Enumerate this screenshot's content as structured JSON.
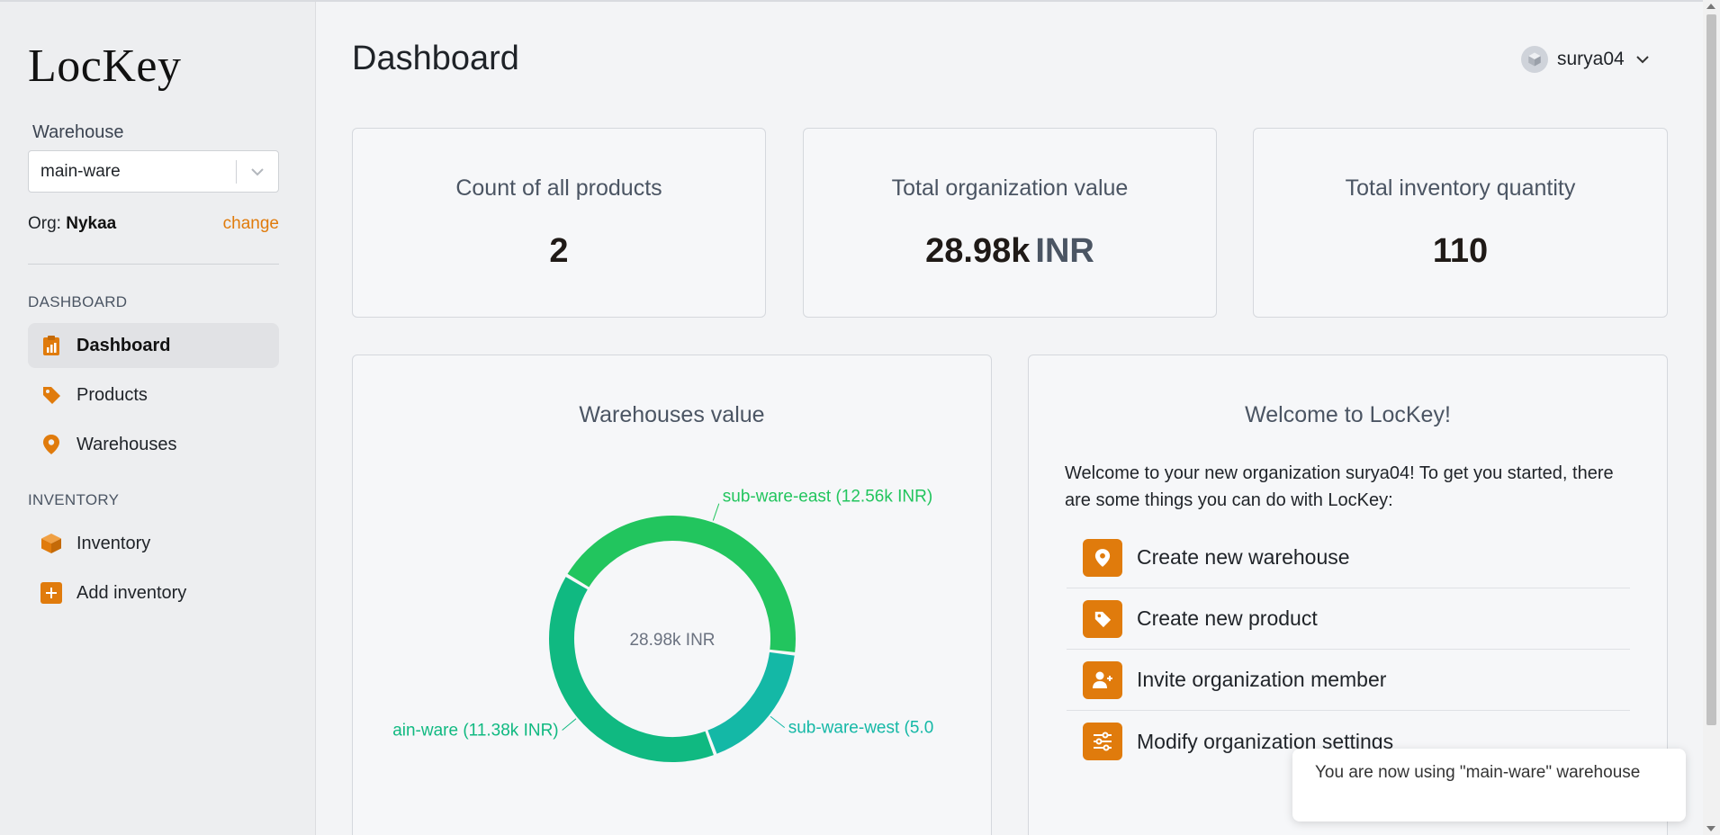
{
  "app": {
    "logo": "LocKey"
  },
  "sidebar": {
    "warehouse_label": "Warehouse",
    "warehouse_value": "main-ware",
    "org_label": "Org:",
    "org_name": "Nykaa",
    "change_label": "change",
    "sections": {
      "dashboard": "DASHBOARD",
      "inventory": "INVENTORY"
    },
    "items": [
      {
        "label": "Dashboard",
        "icon": "clipboard-chart-icon",
        "active": true
      },
      {
        "label": "Products",
        "icon": "tag-icon"
      },
      {
        "label": "Warehouses",
        "icon": "map-pin-icon"
      },
      {
        "label": "Inventory",
        "icon": "cube-icon"
      },
      {
        "label": "Add inventory",
        "icon": "plus-square-icon"
      }
    ]
  },
  "header": {
    "title": "Dashboard",
    "username": "surya04"
  },
  "stats": [
    {
      "label": "Count of all products",
      "value": "2",
      "unit": ""
    },
    {
      "label": "Total organization value",
      "value": "28.98k",
      "unit": "INR"
    },
    {
      "label": "Total inventory quantity",
      "value": "110",
      "unit": ""
    }
  ],
  "warehouses_panel": {
    "title": "Warehouses value"
  },
  "chart_data": {
    "type": "pie",
    "donut": true,
    "title": "Warehouses value",
    "center_label": "28.98k INR",
    "labels": [
      "sub-ware-east (12.56k INR)",
      "sub-ware-west (5.0",
      "ain-ware (11.38k INR)"
    ],
    "series": [
      {
        "name": "sub-ware-east",
        "value": 12.56,
        "color": "#22c55e"
      },
      {
        "name": "sub-ware-west",
        "value": 5.04,
        "color": "#14b8a6"
      },
      {
        "name": "main-ware",
        "value": 11.38,
        "color": "#10b981"
      }
    ],
    "unit": "k INR"
  },
  "welcome": {
    "title": "Welcome to LocKey!",
    "text": "Welcome to your new organization surya04! To get you started, there are some things you can do with LocKey:",
    "actions": [
      {
        "label": "Create new warehouse",
        "icon": "map-pin-icon"
      },
      {
        "label": "Create new product",
        "icon": "tag-icon"
      },
      {
        "label": "Invite organization member",
        "icon": "user-plus-icon"
      },
      {
        "label": "Modify organization settings",
        "icon": "sliders-icon"
      }
    ]
  },
  "toast": {
    "message": "You are now using \"main-ware\" warehouse"
  },
  "colors": {
    "accent": "#e07b0c",
    "chart_green": "#22c55e",
    "chart_teal": "#14b8a6",
    "chart_emerald": "#10b981"
  }
}
